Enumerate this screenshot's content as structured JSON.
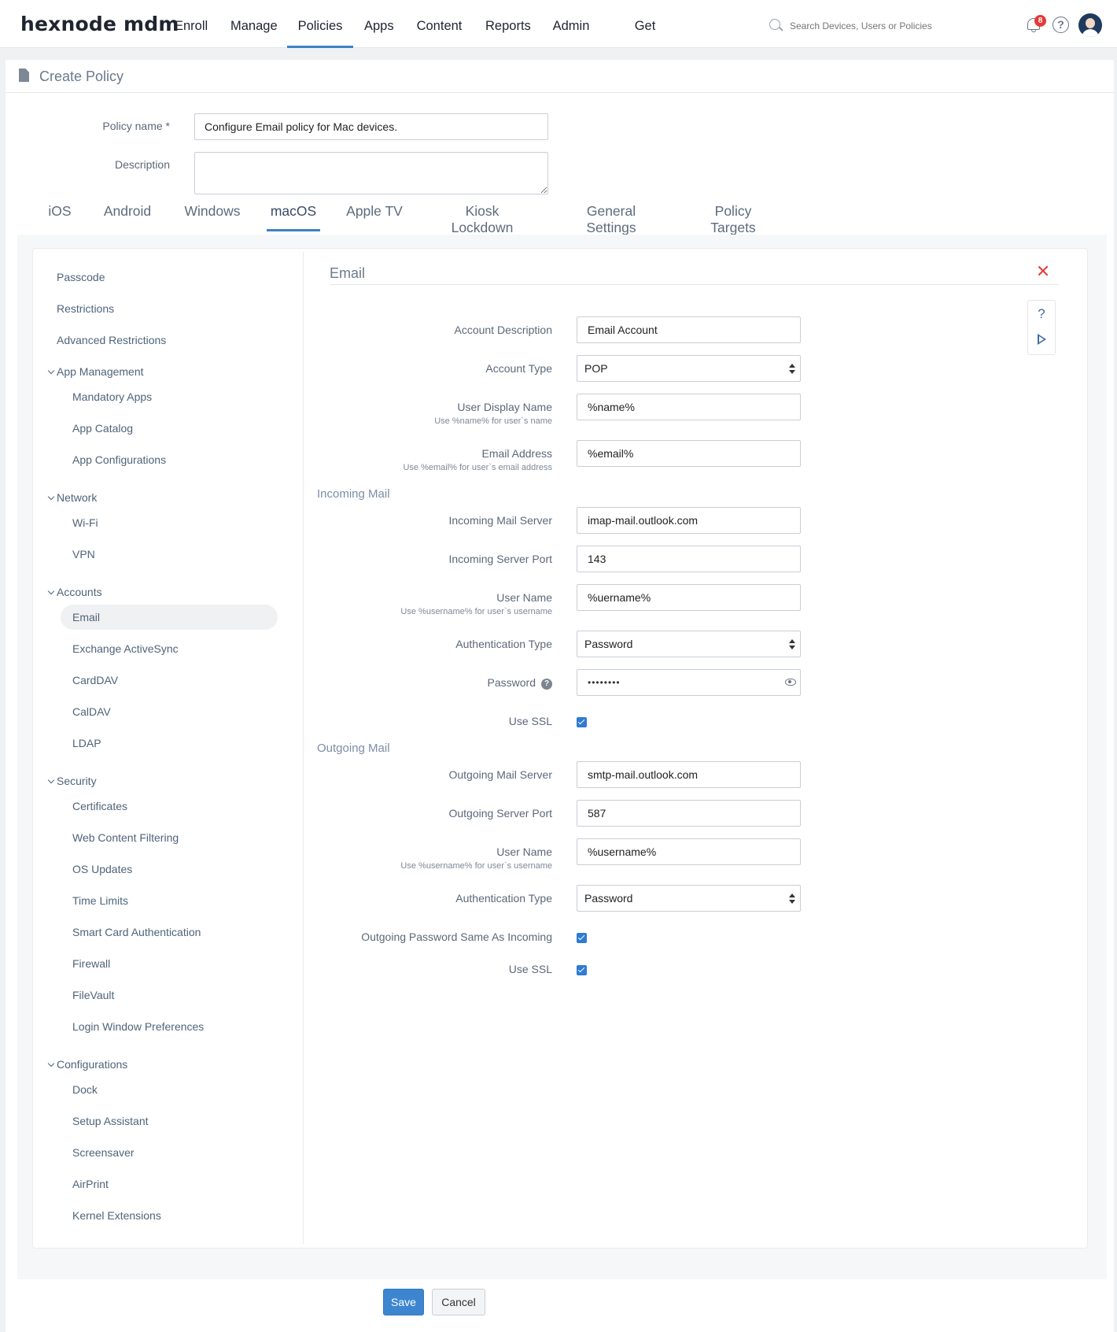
{
  "brand": {
    "logo_text": "hexnode mdm"
  },
  "nav": {
    "items": [
      "Enroll",
      "Manage",
      "Policies",
      "Apps",
      "Content",
      "Reports",
      "Admin",
      "Get Started"
    ],
    "active": "Policies"
  },
  "search": {
    "placeholder": "Search Devices, Users or Policies"
  },
  "notifications": {
    "count": "8"
  },
  "help_icon": "?",
  "page": {
    "title": "Create Policy"
  },
  "policy_form": {
    "name_label": "Policy name *",
    "name_value": "Configure Email policy for Mac devices.",
    "description_label": "Description",
    "description_value": ""
  },
  "platform_tabs": [
    "iOS",
    "Android",
    "Windows",
    "macOS",
    "Apple TV",
    "Kiosk Lockdown",
    "General Settings",
    "Policy Targets"
  ],
  "active_tab": "macOS",
  "sidebar": {
    "top_items": [
      "Passcode",
      "Restrictions",
      "Advanced Restrictions"
    ],
    "groups": [
      {
        "label": "App Management",
        "items": [
          "Mandatory Apps",
          "App Catalog",
          "App Configurations"
        ]
      },
      {
        "label": "Network",
        "items": [
          "Wi-Fi",
          "VPN"
        ]
      },
      {
        "label": "Accounts",
        "items": [
          "Email",
          "Exchange ActiveSync",
          "CardDAV",
          "CalDAV",
          "LDAP"
        ]
      },
      {
        "label": "Security",
        "items": [
          "Certificates",
          "Web Content Filtering",
          "OS Updates",
          "Time Limits",
          "Smart Card Authentication",
          "Firewall",
          "FileVault",
          "Login Window Preferences"
        ]
      },
      {
        "label": "Configurations",
        "items": [
          "Dock",
          "Setup Assistant",
          "Screensaver",
          "AirPrint",
          "Kernel Extensions"
        ]
      }
    ],
    "active_item": "Email"
  },
  "email_section": {
    "title": "Email",
    "help_icon": "?",
    "account_description": {
      "label": "Account Description",
      "value": "Email Account"
    },
    "account_type": {
      "label": "Account Type",
      "value": "POP"
    },
    "user_display_name": {
      "label": "User Display Name",
      "hint": "Use %name% for user`s name",
      "value": "%name%"
    },
    "email_address": {
      "label": "Email Address",
      "hint": "Use %email% for user`s email address",
      "value": "%email%"
    },
    "incoming": {
      "heading": "Incoming Mail",
      "server": {
        "label": "Incoming Mail Server",
        "value": "imap-mail.outlook.com"
      },
      "port": {
        "label": "Incoming Server Port",
        "value": "143"
      },
      "user_name": {
        "label": "User Name",
        "hint": "Use %username% for user`s username",
        "value": "%uername%"
      },
      "auth_type": {
        "label": "Authentication Type",
        "value": "Password"
      },
      "password": {
        "label": "Password",
        "help": "?",
        "value": "••••••••"
      },
      "use_ssl": {
        "label": "Use SSL",
        "checked": true
      }
    },
    "outgoing": {
      "heading": "Outgoing Mail",
      "server": {
        "label": "Outgoing Mail Server",
        "value": "smtp-mail.outlook.com"
      },
      "port": {
        "label": "Outgoing Server Port",
        "value": "587"
      },
      "user_name": {
        "label": "User Name",
        "hint": "Use %username% for user`s username",
        "value": "%username%"
      },
      "auth_type": {
        "label": "Authentication Type",
        "value": "Password"
      },
      "same_password": {
        "label": "Outgoing Password Same As Incoming",
        "checked": true
      },
      "use_ssl": {
        "label": "Use SSL",
        "checked": true
      }
    }
  },
  "actions": {
    "save_label": "Save",
    "cancel_label": "Cancel"
  },
  "colors": {
    "accent": "#3b82c4",
    "primary_button": "#3d86cf",
    "close_red": "#e53935",
    "badge_red": "#e53935"
  }
}
